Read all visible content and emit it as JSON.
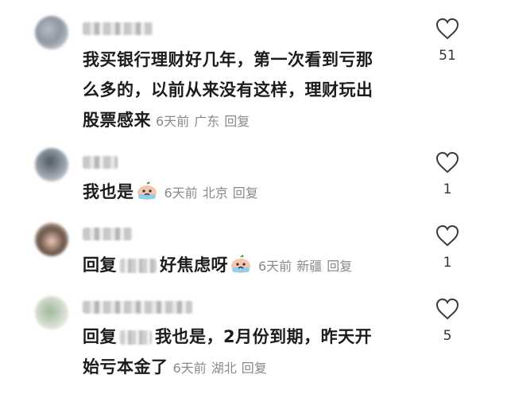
{
  "comments": [
    {
      "text_lines": [
        "我买银行理财好几年，第一次看到亏那",
        "么多的，以前从来没有这样，理财玩出",
        "股票感来"
      ],
      "time": "6天前",
      "location": "广东",
      "reply": "回复",
      "likes": "51"
    },
    {
      "text": "我也是",
      "emoji": "crying-face-emoji",
      "time": "6天前",
      "location": "北京",
      "reply": "回复",
      "likes": "1"
    },
    {
      "reply_prefix": "回复",
      "text": "好焦虑呀",
      "emoji": "crying-face-emoji",
      "time": "6天前",
      "location": "新疆",
      "reply": "回复",
      "likes": "1"
    },
    {
      "reply_prefix": "回复",
      "text_line1": "我也是，2月份到期，昨天开",
      "text_line2": "始亏本金了",
      "time": "6天前",
      "location": "湖北",
      "reply": "回复",
      "likes": "5"
    }
  ]
}
